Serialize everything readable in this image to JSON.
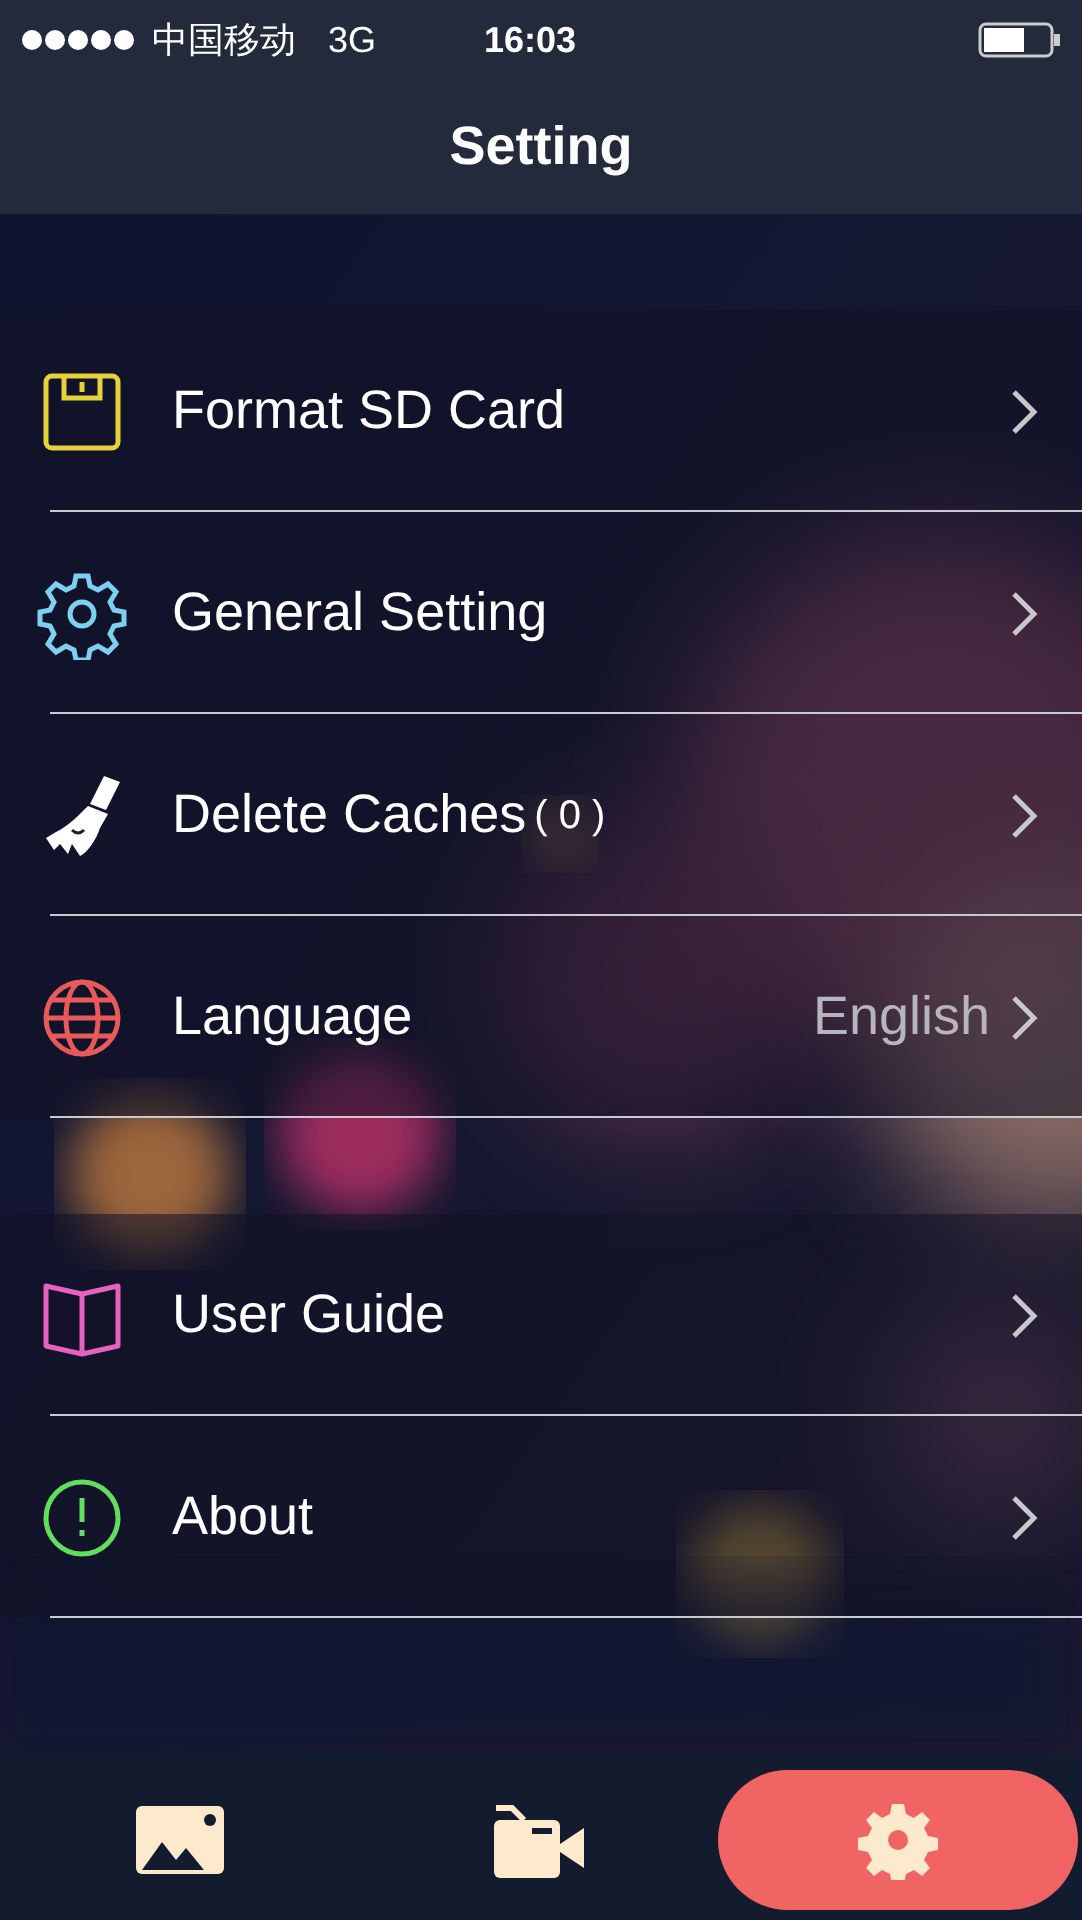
{
  "status_bar": {
    "carrier": "中国移动",
    "network": "3G",
    "time": "16:03"
  },
  "title": "Setting",
  "groups": [
    {
      "items": [
        {
          "kind": "floppy",
          "label": "Format SD Card"
        },
        {
          "kind": "gear",
          "label": "General Setting"
        },
        {
          "kind": "broom",
          "label": "Delete Caches",
          "count": "( 0 )"
        },
        {
          "kind": "globe",
          "label": "Language",
          "value": "English"
        }
      ]
    },
    {
      "items": [
        {
          "kind": "book",
          "label": "User Guide"
        },
        {
          "kind": "info",
          "label": "About"
        }
      ]
    }
  ],
  "tabs": [
    {
      "kind": "photos",
      "selected": false
    },
    {
      "kind": "video",
      "selected": false
    },
    {
      "kind": "settings",
      "selected": true
    }
  ]
}
